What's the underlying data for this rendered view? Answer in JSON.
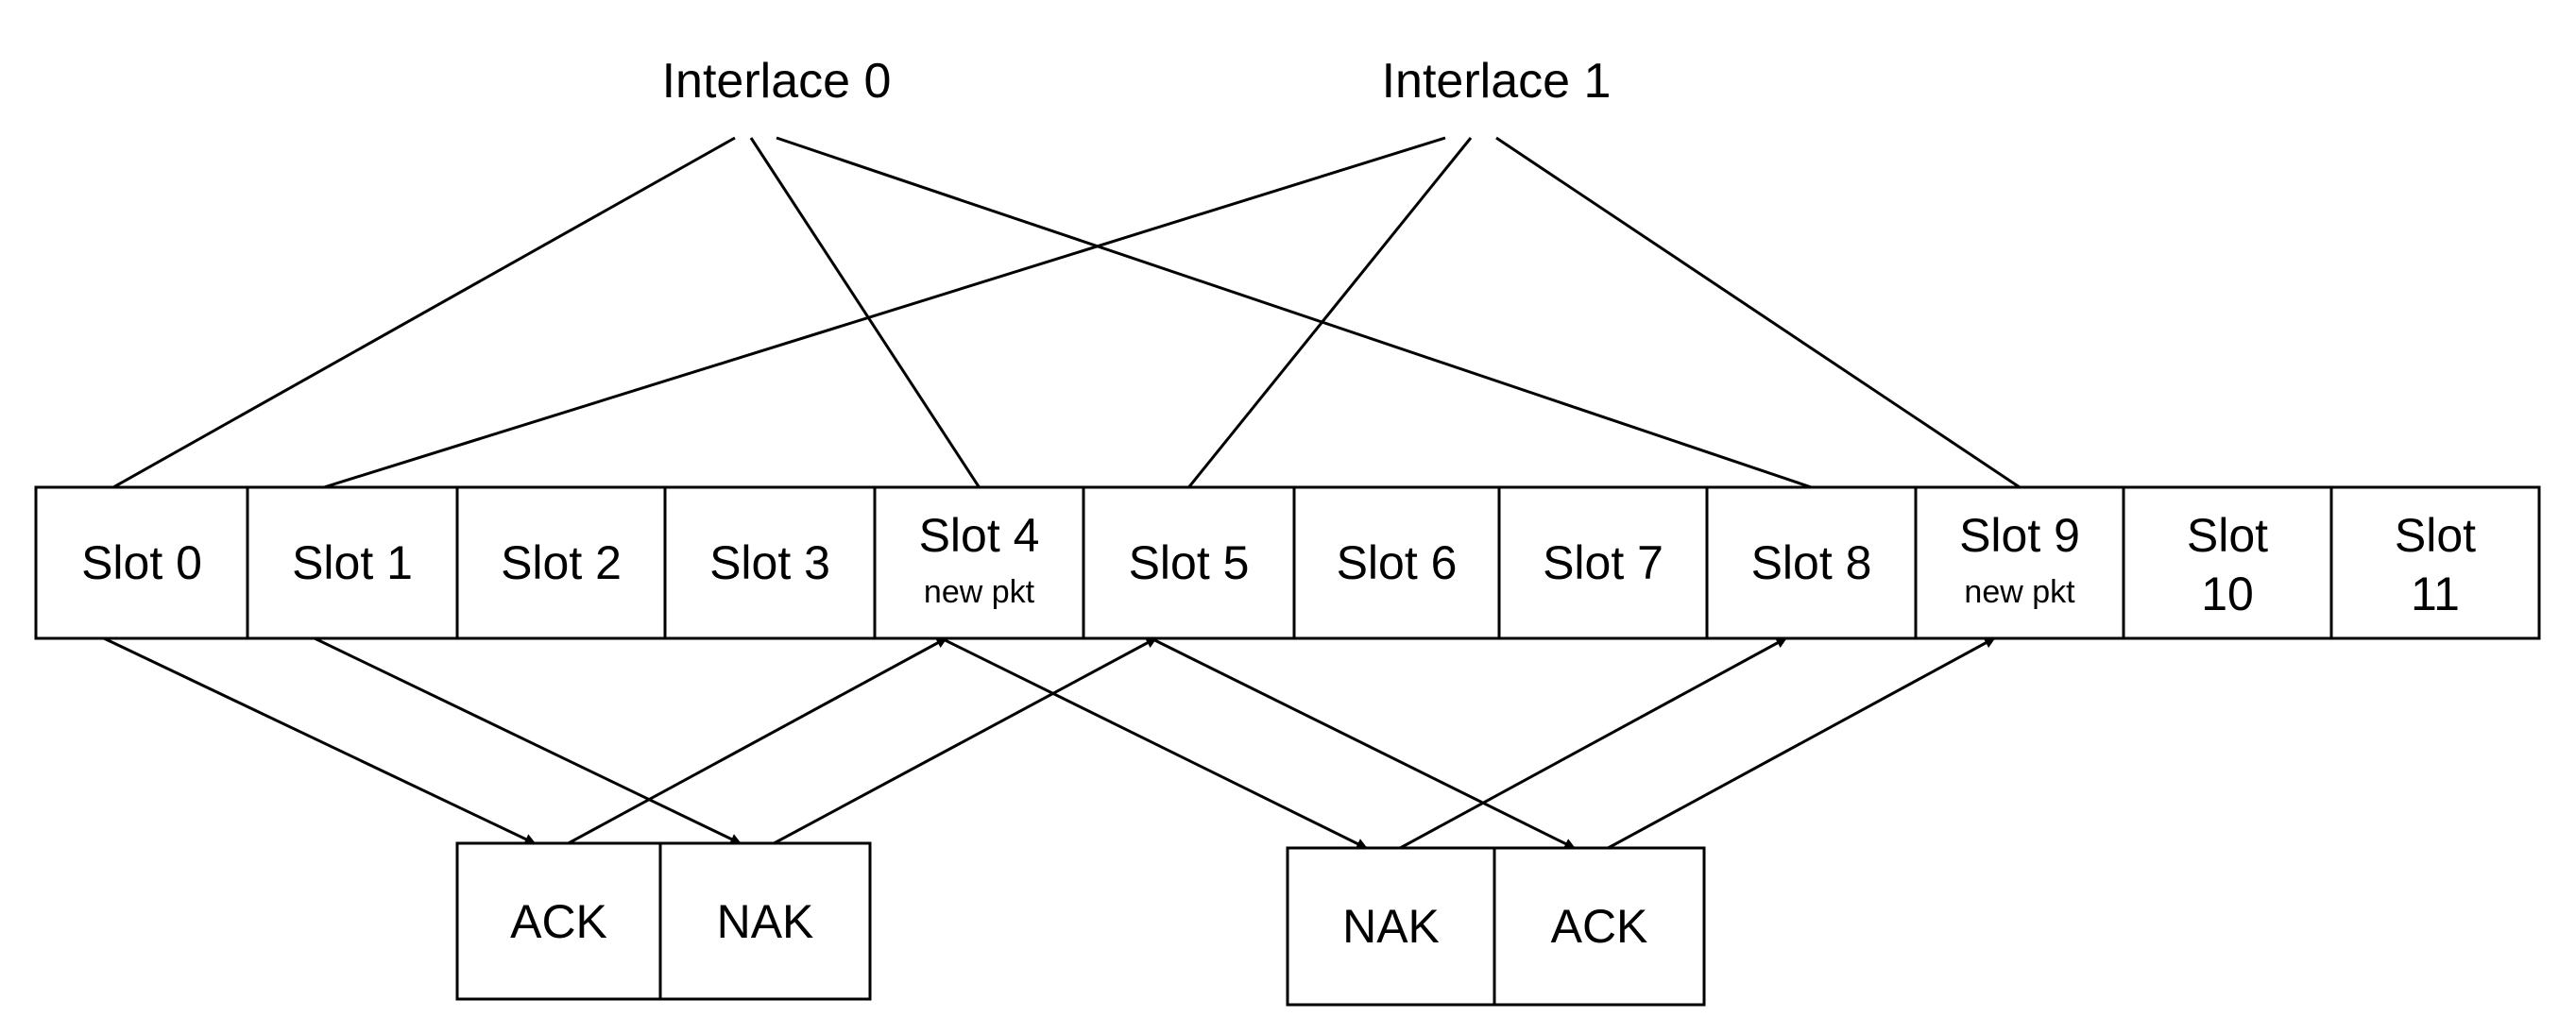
{
  "diagram": {
    "interlaces": [
      {
        "label": "Interlace 0",
        "slots": [
          0,
          4,
          8
        ]
      },
      {
        "label": "Interlace 1",
        "slots": [
          1,
          5,
          9
        ]
      }
    ],
    "slots": [
      {
        "label": "Slot 0",
        "sub": ""
      },
      {
        "label": "Slot 1",
        "sub": ""
      },
      {
        "label": "Slot 2",
        "sub": ""
      },
      {
        "label": "Slot 3",
        "sub": ""
      },
      {
        "label": "Slot 4",
        "sub": "new pkt"
      },
      {
        "label": "Slot 5",
        "sub": ""
      },
      {
        "label": "Slot 6",
        "sub": ""
      },
      {
        "label": "Slot 7",
        "sub": ""
      },
      {
        "label": "Slot 8",
        "sub": ""
      },
      {
        "label": "Slot 9",
        "sub": "new pkt"
      },
      {
        "label": "Slot",
        "sub": "10",
        "two_line": true
      },
      {
        "label": "Slot",
        "sub": "11",
        "two_line": true
      }
    ],
    "feedback_groups": [
      {
        "cells": [
          "ACK",
          "NAK"
        ]
      },
      {
        "cells": [
          "NAK",
          "ACK"
        ]
      }
    ],
    "arrows": [
      {
        "from_slot": 0,
        "to_group": 0,
        "to_cell": 0
      },
      {
        "from_slot": 1,
        "to_group": 0,
        "to_cell": 1
      },
      {
        "from_group": 0,
        "from_cell": 0,
        "to_slot": 4
      },
      {
        "from_group": 0,
        "from_cell": 1,
        "to_slot": 5
      },
      {
        "from_slot": 4,
        "to_group": 1,
        "to_cell": 0
      },
      {
        "from_slot": 5,
        "to_group": 1,
        "to_cell": 1
      },
      {
        "from_group": 1,
        "from_cell": 0,
        "to_slot": 8
      },
      {
        "from_group": 1,
        "from_cell": 1,
        "to_slot": 9
      }
    ]
  }
}
